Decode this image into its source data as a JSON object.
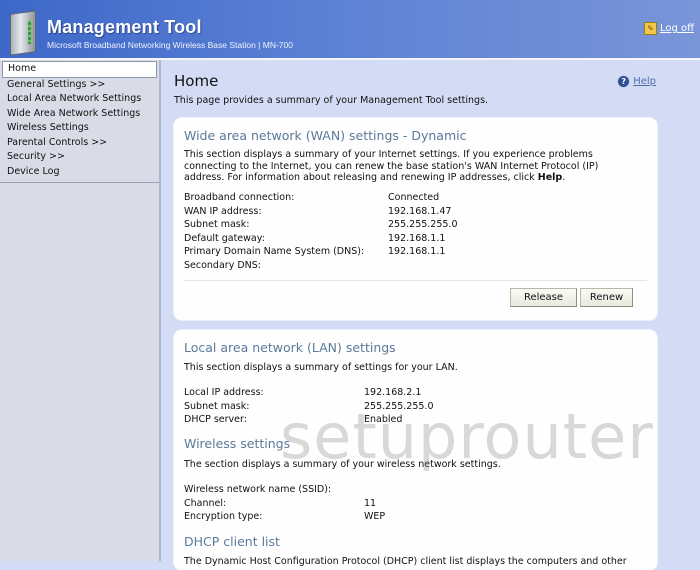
{
  "header": {
    "title": "Management Tool",
    "subtitle": "Microsoft Broadband Networking Wireless Base Station | MN-700",
    "logoff_label": "Log off",
    "logo_icon": "base-station-icon",
    "logoff_icon": "logoff-key-icon"
  },
  "sidebar": {
    "items": [
      {
        "label": "Home",
        "active": true
      },
      {
        "label": "General Settings >>"
      },
      {
        "label": "Local Area Network Settings"
      },
      {
        "label": "Wide Area Network Settings"
      },
      {
        "label": "Wireless Settings"
      },
      {
        "label": "Parental Controls >>"
      },
      {
        "label": "Security >>"
      },
      {
        "label": "Device Log"
      }
    ]
  },
  "main": {
    "title": "Home",
    "description": "This page provides a summary of your Management Tool settings.",
    "help_label": "Help",
    "help_icon": "question-circle-icon"
  },
  "wan": {
    "title": "Wide area network (WAN) settings  -  Dynamic",
    "desc_line1": "This section displays a summary of your Internet settings. If you experience problems",
    "desc_line2": "connecting to the Internet, you can renew the base station's WAN Internet Protocol (IP)",
    "desc_line3": "address. For information about releasing and renewing IP addresses, click ",
    "desc_help": "Help",
    "desc_end": ".",
    "rows": [
      {
        "label": "Broadband connection:",
        "value": "Connected"
      },
      {
        "label": "WAN IP address:",
        "value": "192.168.1.47"
      },
      {
        "label": "Subnet mask:",
        "value": "255.255.255.0"
      },
      {
        "label": "Default gateway:",
        "value": "192.168.1.1"
      },
      {
        "label": "Primary Domain Name System (DNS):",
        "value": "192.168.1.1"
      },
      {
        "label": "Secondary DNS:",
        "value": ""
      }
    ],
    "release_label": "Release",
    "renew_label": "Renew"
  },
  "lan": {
    "title": "Local area network (LAN) settings",
    "desc": "This section displays a summary of settings for your LAN.",
    "rows": [
      {
        "label": "Local IP address:",
        "value": "192.168.2.1"
      },
      {
        "label": "Subnet mask:",
        "value": "255.255.255.0"
      },
      {
        "label": "DHCP server:",
        "value": "Enabled"
      }
    ]
  },
  "wireless": {
    "title": "Wireless settings",
    "desc": "The section displays a summary of your wireless network settings.",
    "rows": [
      {
        "label": "Wireless network name (SSID):",
        "value": ""
      },
      {
        "label": "Channel:",
        "value": "11"
      },
      {
        "label": "Encryption type:",
        "value": "WEP"
      }
    ]
  },
  "dhcp": {
    "title": "DHCP client list",
    "desc": "The Dynamic Host Configuration Protocol (DHCP) client list displays the computers and other"
  },
  "watermark": "setuprouter"
}
